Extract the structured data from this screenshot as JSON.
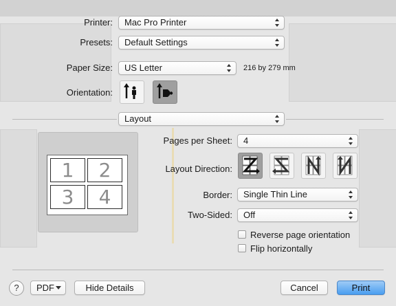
{
  "printer": {
    "label": "Printer:",
    "value": "Mac Pro Printer"
  },
  "presets": {
    "label": "Presets:",
    "value": "Default Settings"
  },
  "paper_size": {
    "label": "Paper Size:",
    "value": "US Letter",
    "dimensions": "216 by 279 mm"
  },
  "orientation": {
    "label": "Orientation:",
    "selected": "landscape"
  },
  "section_popup": {
    "value": "Layout"
  },
  "preview": {
    "pages": [
      "1",
      "2",
      "3",
      "4"
    ]
  },
  "pages_per_sheet": {
    "label": "Pages per Sheet:",
    "value": "4"
  },
  "layout_direction": {
    "label": "Layout Direction:",
    "selected_index": 0
  },
  "border": {
    "label": "Border:",
    "value": "Single Thin Line"
  },
  "two_sided": {
    "label": "Two-Sided:",
    "value": "Off"
  },
  "reverse_orientation": {
    "label": "Reverse page orientation",
    "checked": false
  },
  "flip_horizontally": {
    "label": "Flip horizontally",
    "checked": false
  },
  "footer": {
    "help": "?",
    "pdf": "PDF",
    "hide_details": "Hide Details",
    "cancel": "Cancel",
    "print": "Print"
  }
}
